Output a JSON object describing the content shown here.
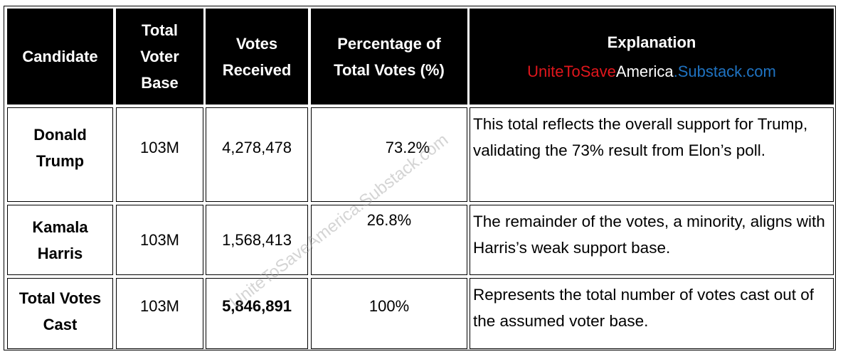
{
  "table": {
    "headers": {
      "candidate": "Candidate",
      "voter_base": [
        "Total",
        "Voter",
        "Base"
      ],
      "votes_received": [
        "Votes",
        "Received"
      ],
      "percentage": [
        "Percentage of",
        "Total Votes (%)"
      ],
      "explanation": "Explanation",
      "brand": {
        "part1": "UniteToSave",
        "part2": "America",
        "part3": ".Substack.com",
        "colors": {
          "part1": "#e0161c",
          "part2": "#ffffff",
          "part3": "#1f73c2"
        }
      }
    },
    "rows": [
      {
        "candidate": [
          "Donald",
          "Trump"
        ],
        "voter_base": "103M",
        "votes_received": "4,278,478",
        "percentage": "73.2%",
        "explanation": "This total reflects the overall support for Trump, validating the 73% result from Elon’s poll."
      },
      {
        "candidate": [
          "Kamala",
          "Harris"
        ],
        "voter_base": "103M",
        "votes_received": "1,568,413",
        "percentage": "26.8%",
        "explanation": "The remainder of the votes, a minority, aligns with Harris’s weak support base."
      },
      {
        "candidate": [
          "Total Votes",
          "Cast"
        ],
        "voter_base": "103M",
        "votes_received": "5,846,891",
        "percentage": "100%",
        "explanation": "Represents the total number of votes cast out of the assumed voter base."
      }
    ]
  },
  "watermark": "UniteToSaveAmerica.Substack.com"
}
